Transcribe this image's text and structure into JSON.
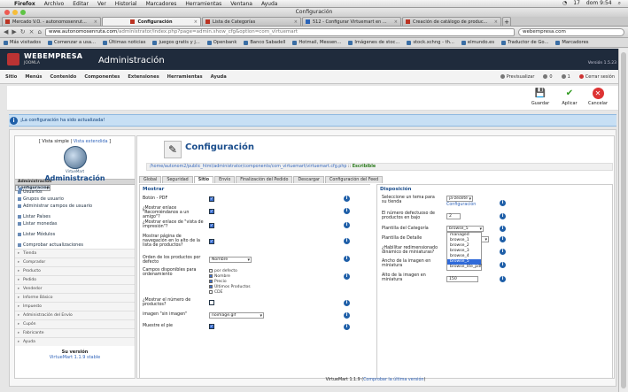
{
  "mac": {
    "menus": [
      "Firefox",
      "Archivo",
      "Editar",
      "Ver",
      "Historial",
      "Marcadores",
      "Herramientas",
      "Ventana",
      "Ayuda"
    ],
    "battery": "17",
    "clock": "dom 9:54"
  },
  "window_title": "Configuración",
  "tabs": [
    {
      "label": "Mercado V.O. - autonomosenrut...",
      "active": false
    },
    {
      "label": "Configuración",
      "active": true
    },
    {
      "label": "Lista de Categorías",
      "active": false
    },
    {
      "label": "512 - Configurar Virtuemart en ...",
      "active": false
    },
    {
      "label": "Creación de catálogo de produc...",
      "active": false
    }
  ],
  "url": {
    "host": "www.autonomosenruta.com",
    "path": "/administrator/index.php?page=admin.show_cfg&option=com_virtuemart"
  },
  "search_value": "webempresa.com",
  "bookmarks": [
    "Más visitados",
    "Comenzar a usa...",
    "Últimas noticias",
    "juegos gratis y j...",
    "Openbank",
    "Banco Sabadell",
    "Hotmail, Messen...",
    "Imágenes de stoc...",
    "stock.xchng - th...",
    "elmundo.es",
    "Traductor de Go...",
    "Marcadores"
  ],
  "joomla": {
    "brand": "WEBEMPRESA",
    "sub": "JOOMLA",
    "admin_title": "Administración",
    "version": "Versión 1.5.23"
  },
  "menubar": {
    "items": [
      "Sitio",
      "Menús",
      "Contenido",
      "Componentes",
      "Extensiones",
      "Herramientas",
      "Ayuda"
    ],
    "preview": "Previsualizar",
    "messages": "0",
    "users": "1",
    "logout": "Cerrar sesión"
  },
  "toolbar": {
    "save": "Guardar",
    "apply": "Aplicar",
    "cancel": "Cancelar"
  },
  "message": "¡La configuración ha sido actualizada!",
  "sidebar": {
    "view_simple": "[ Vista simple | ",
    "view_extended": "Vista extendida",
    "view_close": " ]",
    "logo_text": "VirtueMart",
    "title": "Administración",
    "admin_header": "Administración",
    "admin_items": [
      "Configuración",
      "Usuarios",
      "Grupos de usuario",
      "Administrar campos de usuario",
      "Listar Países",
      "Listar monedas",
      "Listar Módulos",
      "Comprobar actualizaciones"
    ],
    "categories": [
      "Tienda",
      "Comprador",
      "Producto",
      "Pedido",
      "Vendedor",
      "Informe Básico",
      "Impuesto",
      "Administración del Envío",
      "Cupón",
      "Fabricante",
      "Ayuda"
    ],
    "version_label": "Su versión",
    "version_value": "VirtueMart 1.1.9 stable"
  },
  "main": {
    "title": "Configuración",
    "config_path": "/home/autonom2/public_html/administrator/components/com_virtuemart/virtuemart.cfg.php",
    "writable": "Escribible",
    "tabs": [
      "Global",
      "Seguridad",
      "Sitio",
      "Envío",
      "Finalización del Pedido",
      "Descargar",
      "Configuración del Feed"
    ],
    "active_tab": "Sitio",
    "left_title": "Mostrar",
    "left_rows": [
      {
        "label": "Botón - PDF",
        "checked": true
      },
      {
        "label": "¿Mostrar enlace \"Recomiéndanos a un amigo\"?",
        "checked": true
      },
      {
        "label": "¿Mostrar enlace de \"vista de impresión\"?",
        "checked": true
      },
      {
        "label": "Mostrar página de navegación en lo alto de la lista de productos?",
        "checked": true
      }
    ],
    "order_label": "Orden de los productos por defecto",
    "order_value": "Nombre",
    "fields_label": "Campos disponibles para ordenamiento",
    "fields": [
      {
        "label": "por defecto",
        "checked": false
      },
      {
        "label": "Nombre",
        "checked": true
      },
      {
        "label": "Precio",
        "checked": true
      },
      {
        "label": "Últimos Productos",
        "checked": true
      },
      {
        "label": "CDE",
        "checked": false
      }
    ],
    "qty_label": "¿Mostrar el número de productos?",
    "noimage_label": "imagen \"sin imagen\"",
    "noimage_value": "noimage.gif",
    "show_footer_label": "Muestre el pie",
    "right_title": "Disposición",
    "theme_label": "Seleccione un tema para su tienda",
    "theme_value": "ja-zeolite",
    "theme_link": "Configuración",
    "per_row_label": "El número defectuoso de productos en bajo",
    "per_row_value": "2",
    "cat_tpl_label": "Plantilla del Categoría",
    "cat_tpl_value": "browse_5",
    "detail_tpl_label": "Plantilla de Detalle",
    "thumb_label": "¿Habilitar redimensionado dinámico de miniaturas?",
    "width_label": "Ancho de la imagen en miniatura",
    "height_label": "Alto de la imagen en miniatura",
    "height_value": "150",
    "dropdown_options": [
      "managed",
      "browse_1",
      "browse_2",
      "browse_3",
      "browse_4",
      "browse_5",
      "browse_lite_pdf"
    ],
    "dropdown_selected": "browse_5"
  },
  "footer": {
    "prefix": "VirtueMart 1.1.9 (",
    "link": "Comprobar la última versión",
    "suffix": ")"
  }
}
